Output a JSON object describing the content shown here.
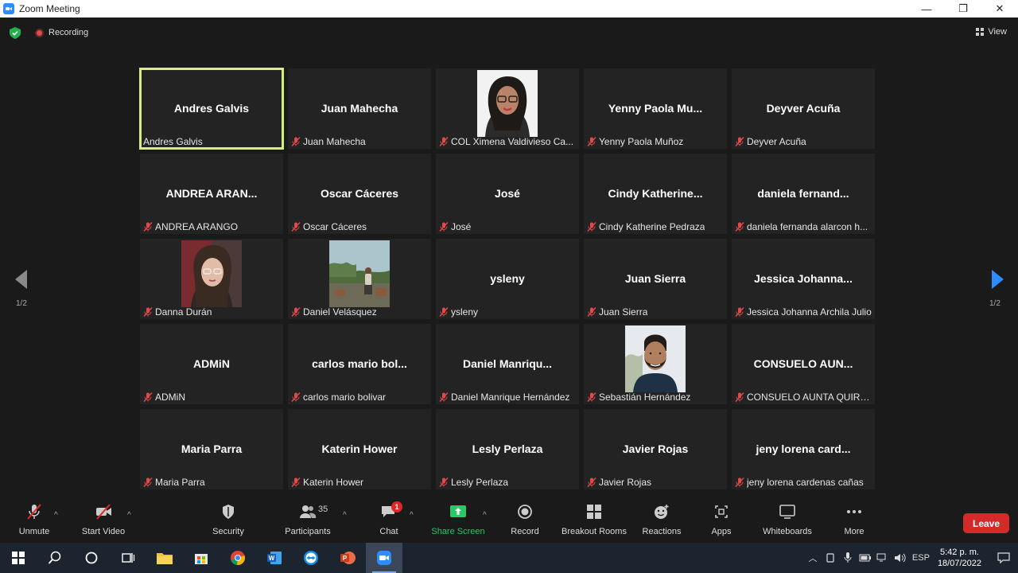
{
  "window": {
    "title": "Zoom Meeting",
    "minimize": "—",
    "restore": "❐",
    "close": "✕"
  },
  "topbar": {
    "recording": "Recording",
    "view": "View"
  },
  "gallery": {
    "page_left": "1/2",
    "page_right": "1/2",
    "tiles": [
      {
        "center": "Andres Galvis",
        "label": "Andres Galvis",
        "active": true,
        "muted": false
      },
      {
        "center": "Juan Mahecha",
        "label": "Juan Mahecha",
        "muted": true
      },
      {
        "center": "",
        "label": "COL Ximena Valdivieso Ca...",
        "muted": true,
        "photo": "woman-glasses"
      },
      {
        "center": "Yenny Paola Mu...",
        "label": "Yenny Paola Muñoz",
        "muted": true
      },
      {
        "center": "Deyver Acuña",
        "label": "Deyver Acuña",
        "muted": true
      },
      {
        "center": "ANDREA ARAN...",
        "label": "ANDREA ARANGO",
        "muted": true
      },
      {
        "center": "Oscar Cáceres",
        "label": "Oscar Cáceres",
        "muted": true
      },
      {
        "center": "José",
        "label": "José",
        "muted": true
      },
      {
        "center": "Cindy Katherine...",
        "label": "Cindy Katherine Pedraza",
        "muted": true
      },
      {
        "center": "daniela fernand...",
        "label": "daniela fernanda alarcon h...",
        "muted": true
      },
      {
        "center": "",
        "label": "Danna Durán",
        "muted": true,
        "photo": "young-woman"
      },
      {
        "center": "",
        "label": "Daniel Velásquez",
        "muted": true,
        "photo": "outdoor"
      },
      {
        "center": "ysleny",
        "label": "ysleny",
        "muted": true
      },
      {
        "center": "Juan Sierra",
        "label": "Juan Sierra",
        "muted": true
      },
      {
        "center": "Jessica Johanna...",
        "label": "Jessica Johanna Archila Julio",
        "muted": true
      },
      {
        "center": "ADMiN",
        "label": "ADMiN",
        "muted": true
      },
      {
        "center": "carlos mario bol...",
        "label": "carlos mario bolivar",
        "muted": true
      },
      {
        "center": "Daniel Manriqu...",
        "label": "Daniel Manrique Hernández",
        "muted": true
      },
      {
        "center": "",
        "label": "Sebastián Hernández",
        "muted": true,
        "photo": "man-beard"
      },
      {
        "center": "CONSUELO AUN...",
        "label": "CONSUELO AUNTA QUIRO...",
        "muted": true
      },
      {
        "center": "Maria Parra",
        "label": "Maria Parra",
        "muted": true
      },
      {
        "center": "Katerin Hower",
        "label": "Katerin Hower",
        "muted": true
      },
      {
        "center": "Lesly Perlaza",
        "label": "Lesly Perlaza",
        "muted": true
      },
      {
        "center": "Javier Rojas",
        "label": "Javier Rojas",
        "muted": true
      },
      {
        "center": "jeny lorena card...",
        "label": "jeny lorena cardenas cañas",
        "muted": true
      }
    ]
  },
  "toolbar": {
    "unmute": "Unmute",
    "start_video": "Start Video",
    "security": "Security",
    "participants": "Participants",
    "participants_count": "35",
    "chat": "Chat",
    "chat_badge": "1",
    "share": "Share Screen",
    "record": "Record",
    "breakout": "Breakout Rooms",
    "reactions": "Reactions",
    "apps": "Apps",
    "whiteboards": "Whiteboards",
    "more": "More",
    "leave": "Leave",
    "caret": "^"
  },
  "taskbar": {
    "lang": "ESP",
    "time": "5:42 p. m.",
    "date": "18/07/2022"
  },
  "colors": {
    "active_border": "#d6ef7a",
    "share_green": "#2ac866",
    "leave_red": "#d52a2a",
    "accent_blue": "#2d8cff"
  }
}
